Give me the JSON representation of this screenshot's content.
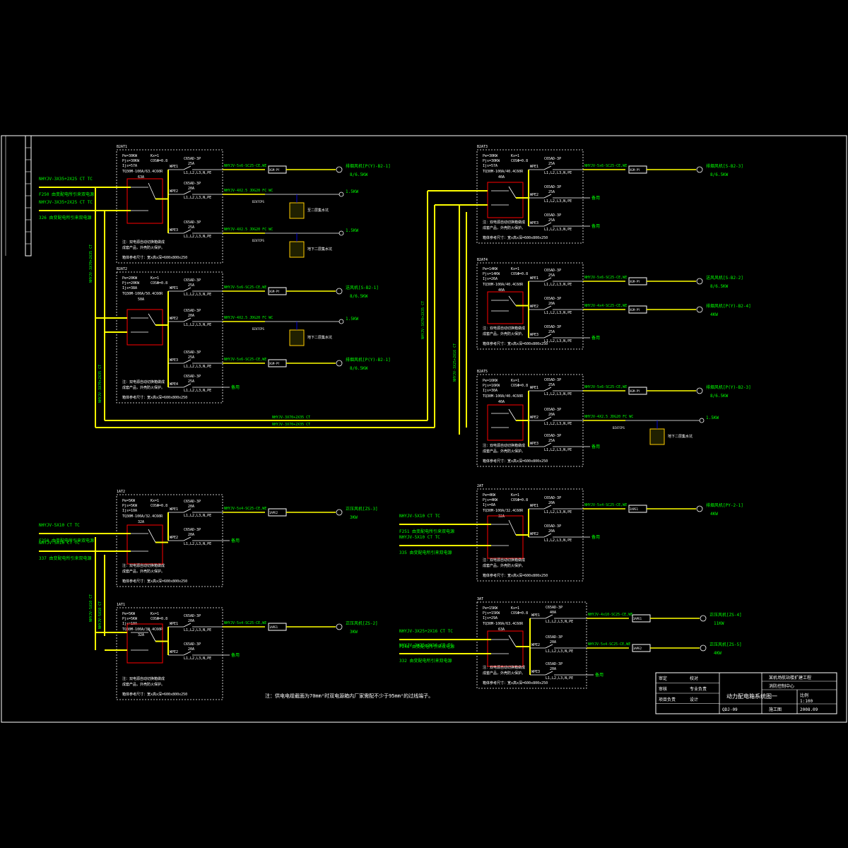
{
  "note": "注：供电电缆截面为70mm²时双电源箱内厂家需配不少于95mm²的过线端子。",
  "title_block": {
    "project": "某机场航站楼扩建工程",
    "sub_project": "消防控制中心",
    "drawing_title": "动力配电箱系统图一",
    "drawing_no": "QDJ-09",
    "labels": [
      "审定",
      "校对",
      "审核",
      "专业负责",
      "设计",
      "项目负责"
    ],
    "scale_label": "比例",
    "scale": "1:100",
    "date": "2008.09",
    "stage": "施工图"
  },
  "panels": [
    {
      "id": "AP1",
      "name": "B2AT1",
      "params": [
        "Pe=30KW",
        "Kx=1",
        "Pjs=30KW",
        "COSΦ=0.8",
        "Ijs=57A"
      ],
      "atse": "TQ30M-100A/63.4C60R",
      "atse_rating": "63A",
      "sources": [
        {
          "cable": "NHYJV-3X35+2X25 CT TC",
          "desc": "F250 由变配电所引来双电源"
        },
        {
          "cable": "NHYJV-3X35+2X25 CT TC",
          "desc": "326 由变配电所引来双电源"
        }
      ],
      "notes": [
        "注：双电源自动切换箱做成",
        "成套产品，外壳防火保护。"
      ],
      "size": "箱体参考尺寸：宽x高x深=600x800x250",
      "circuits": [
        {
          "no": "WPE1",
          "breaker": "C65AD-3P",
          "rating": "25A",
          "phase": "L1,L2,L3,N,PE",
          "cable": "NHYJV-5x6-SC25-CE,WE",
          "device": "XGM-PY",
          "load": "排烟风机[P(Y)-B2-1]",
          "power": "8/6.5KW"
        },
        {
          "no": "WPE2",
          "breaker": "C65AD-3P",
          "rating": "20A",
          "phase": "L1,L2,L3,N,PE",
          "cable": "NHYJV-4X2.5 JDG20 FC WC",
          "device": "DZ47CPS",
          "load": "1.5KW",
          "extra": "至二层集水坑"
        },
        {
          "no": "WPE3",
          "breaker": "C65AD-3P",
          "rating": "25A",
          "phase": "L1,L2,L3,N,PE",
          "cable": "NHYJV-4X2.5 JDG20 FC WC",
          "device": "DZ47CPS",
          "load": "1.5KW",
          "extra": "地下二层集水坑"
        }
      ]
    },
    {
      "id": "AP2",
      "name": "B2AT2",
      "params": [
        "Pe=20KW",
        "Kx=1",
        "Pjs=20KW",
        "COSΦ=0.8",
        "Ijs=38A"
      ],
      "atse": "TQ30M-100A/50.4C60R",
      "atse_rating": "50A",
      "notes": [
        "注：双电源自动切换箱做成",
        "成套产品，外壳防火保护。"
      ],
      "size": "箱体参考尺寸：宽x高x深=600x800x250",
      "circuits": [
        {
          "no": "WPE1",
          "breaker": "C65AD-3P",
          "rating": "25A",
          "phase": "L1,L2,L3,N,PE",
          "cable": "NHYJV-5x6-SC25-CE,WE",
          "device": "XGM-PY",
          "load": "送风机[S-B2-1]",
          "power": "8/6.5KW"
        },
        {
          "no": "WPE2",
          "breaker": "C65AD-3P",
          "rating": "20A",
          "phase": "L1,L2,L3,N,PE",
          "cable": "NHYJV-4X2.5 JDG20 FC WC",
          "device": "DZ47CPS",
          "load": "1.5KW",
          "extra": "地下二层集水坑"
        },
        {
          "no": "WPE3",
          "breaker": "C65AD-3P",
          "rating": "25A",
          "phase": "L1,L2,L3,N,PE",
          "cable": "NHYJV-5x6-SC25-CE,WE",
          "device": "XGM-PY",
          "load": "排烟风机[P(Y)-B2-1]",
          "power": "8/6.5KW"
        },
        {
          "no": "WPE4",
          "breaker": "C65AD-3P",
          "rating": "25A",
          "phase": "L1,L2,L3,N,PE",
          "load": "备用"
        }
      ]
    },
    {
      "id": "AP3",
      "name": "B2AT3",
      "params": [
        "Pe=30KW",
        "Kx=1",
        "Pjs=30KW",
        "COSΦ=0.8",
        "Ijs=57A"
      ],
      "atse": "TQ30M-100A/40.4C60R",
      "atse_rating": "40A",
      "notes": [
        "注：双电源自动切换箱做成",
        "成套产品，外壳防火保护。"
      ],
      "size": "箱体参考尺寸：宽x高x深=600x800x250",
      "circuits": [
        {
          "no": "WPE1",
          "breaker": "C65AD-3P",
          "rating": "25A",
          "phase": "L1,L2,L3,N,PE",
          "cable": "NHYJV-5x6-SC25-CE,WE",
          "device": "XGM-PY",
          "load": "排烟风机[S-B2-3]",
          "power": "8/6.5KW"
        },
        {
          "no": "WPE2",
          "breaker": "C65AD-3P",
          "rating": "25A",
          "phase": "L1,L2,L3,N,PE",
          "load": "备用"
        },
        {
          "no": "WPE3",
          "breaker": "C65AD-3P",
          "rating": "25A",
          "phase": "L1,L2,L3,N,PE",
          "load": "备用"
        }
      ]
    },
    {
      "id": "AP4",
      "name": "B2AT4",
      "params": [
        "Pe=14KW",
        "Kx=1",
        "Pjs=14KW",
        "COSΦ=0.8",
        "Ijs=26A"
      ],
      "atse": "TQ30M-100A/40.4C60R",
      "atse_rating": "40A",
      "notes": [
        "注：双电源自动切换箱做成",
        "成套产品，外壳防火保护。"
      ],
      "size": "箱体参考尺寸：宽x高x深=600x800x250",
      "circuits": [
        {
          "no": "WPE1",
          "breaker": "C65AD-3P",
          "rating": "25A",
          "phase": "L1,L2,L3,N,PE",
          "cable": "NHYJV-5x6-SC25-CE,WE",
          "device": "XGM-PY",
          "load": "送风风机[S-B2-2]",
          "power": "8/6.5KW"
        },
        {
          "no": "WPE2",
          "breaker": "C65AD-3P",
          "rating": "20A",
          "phase": "L1,L2,L3,N,PE",
          "cable": "NHYJV-4x4-SC25-CE,WE",
          "device": "XGM-PY",
          "load": "排烟风机[P(Y)-B2-4]",
          "power": "4KW"
        },
        {
          "no": "WPE3",
          "breaker": "C65AD-3P",
          "rating": "25A",
          "phase": "L1,L2,L3,N,PE",
          "load": "备用"
        }
      ]
    },
    {
      "id": "AP5",
      "name": "B2AT5",
      "params": [
        "Pe=16KW",
        "Kx=1",
        "Pjs=16KW",
        "COSΦ=0.8",
        "Ijs=30A"
      ],
      "atse": "TQ30M-100A/40.4C60R",
      "atse_rating": "40A",
      "notes": [
        "注：双电源自动切换箱做成",
        "成套产品，外壳防火保护。"
      ],
      "size": "箱体参考尺寸：宽x高x深=600x800x250",
      "circuits": [
        {
          "no": "WPE1",
          "breaker": "C65AD-3P",
          "rating": "25A",
          "phase": "L1,L2,L3,N,PE",
          "cable": "NHYJV-5x6-SC25-CE,WE",
          "device": "XGM-PY",
          "load": "排烟风机[P(Y)-B2-3]",
          "power": "8/6.5KW"
        },
        {
          "no": "WPE2",
          "breaker": "C65AD-3P",
          "rating": "20A",
          "phase": "L1,L2,L3,N,PE",
          "cable": "NHYJV-4X2.5 JDG20 FC WC",
          "device": "DZ47CPS",
          "load": "1.5KW",
          "extra": "地下二层集水坑"
        },
        {
          "no": "WPE3",
          "breaker": "C65AD-3P",
          "rating": "25A",
          "phase": "L1,L2,L3,N,PE",
          "load": "备用"
        }
      ]
    },
    {
      "id": "AP6",
      "name": "1AT2",
      "params": [
        "Pe=5KW",
        "Kx=1",
        "Pjs=5KW",
        "COSΦ=0.8",
        "Ijs=10A"
      ],
      "atse": "TQ30M-100A/32.4C60R",
      "atse_rating": "32A",
      "sources": [
        {
          "cable": "NHYJV-5X10 CT TC",
          "desc": "F250 由变配电所引来双电源"
        },
        {
          "cable": "NHYJV-5X10 CT TC",
          "desc": "337 由变配电所引来双电源"
        }
      ],
      "notes": [
        "注：双电源自动切换箱做成",
        "成套产品，外壳防火保护。"
      ],
      "size": "箱体参考尺寸：宽x高x深=600x800x250",
      "circuits": [
        {
          "no": "WPE1",
          "breaker": "C65AD-3P",
          "rating": "20A",
          "phase": "L1,L2,L3,N,PE",
          "cable": "NHYJV-5x4-SC25-CE,WE",
          "device": "1APE2",
          "load": "正压风机[ZS-3]",
          "power": "3KW"
        },
        {
          "no": "WPE2",
          "breaker": "C65AD-3P",
          "rating": "20A",
          "phase": "L1,L2,L3,N,PE",
          "load": "备用"
        }
      ]
    },
    {
      "id": "AP7",
      "name": "1AT1",
      "params": [
        "Pe=5KW",
        "Kx=1",
        "Pjs=5KW",
        "COSΦ=0.8",
        "Ijs=10A"
      ],
      "atse": "TQ30M-100A/32.4C60R",
      "atse_rating": "32A",
      "notes": [
        "注：双电源自动切换箱做成",
        "成套产品，外壳防火保护。"
      ],
      "size": "箱体参考尺寸：宽x高x深=600x800x250",
      "circuits": [
        {
          "no": "WPE1",
          "breaker": "C65AD-3P",
          "rating": "20A",
          "phase": "L1,L2,L3,N,PE",
          "cable": "NHYJV-5x4-SC25-CE,WE",
          "device": "1APE1",
          "load": "正压风机[ZS-2]",
          "power": "3KW"
        },
        {
          "no": "WPE2",
          "breaker": "C65AD-3P",
          "rating": "20A",
          "phase": "L1,L2,L3,N,PE",
          "load": "备用"
        }
      ]
    },
    {
      "id": "AP8",
      "name": "2AT",
      "params": [
        "Pe=4KW",
        "Kx=1",
        "Pjs=4KW",
        "COSΦ=0.8",
        "Ijs=8A"
      ],
      "atse": "TQ30M-100A/32.4C60R",
      "atse_rating": "32A",
      "sources": [
        {
          "cable": "NHYJV-5X10 CT TC",
          "desc": "F251 由变配电所引来双电源"
        },
        {
          "cable": "NHYJV-5X10 CT TC",
          "desc": "335 由变配电所引来双电源"
        }
      ],
      "notes": [
        "注：双电源自动切换箱做成",
        "成套产品，外壳防火保护。"
      ],
      "size": "箱体参考尺寸：宽x高x深=600x800x250",
      "circuits": [
        {
          "no": "WPE1",
          "breaker": "C65AD-3P",
          "rating": "20A",
          "phase": "L1,L2,L3,N,PE",
          "cable": "NHYJV-5x4-SC25-CE,WE",
          "device": "2APE1",
          "load": "排烟风机[PY-2-1]",
          "power": "4KW"
        },
        {
          "no": "WPE2",
          "breaker": "C65AD-3P",
          "rating": "20A",
          "phase": "L1,L2,L3,N,PE",
          "load": "备用"
        }
      ]
    },
    {
      "id": "AP9",
      "name": "3AT",
      "params": [
        "Pe=15KW",
        "Kx=1",
        "Pjs=15KW",
        "COSΦ=0.8",
        "Ijs=29A"
      ],
      "atse": "TQ30M-100A/63.4C60R",
      "atse_rating": "63A",
      "sources": [
        {
          "cable": "NHYJV-3X25+2X16 CT TC",
          "desc": "F248 由变配电所引来双电源"
        },
        {
          "cable": "NHYJV-3X25+2X16 CT TC",
          "desc": "332 由变配电所引来双电源"
        }
      ],
      "notes": [
        "注：双电源自动切换箱做成",
        "成套产品，外壳防火保护。"
      ],
      "size": "箱体参考尺寸：宽x高x深=600x800x250",
      "circuits": [
        {
          "no": "WPE1",
          "breaker": "C65AD-3P",
          "rating": "40A",
          "phase": "L1,L2,L3,N,PE",
          "cable": "NHYJV-4x10-SC25-CE,WE",
          "device": "3APE1",
          "load": "正压风机[ZS-4]",
          "power": "11KW"
        },
        {
          "no": "WPE2",
          "breaker": "C65AD-3P",
          "rating": "20A",
          "phase": "L1,L2,L3,N,PE",
          "cable": "NHYJV-5x4-SC25-CE,WE",
          "device": "3APE2",
          "load": "正压风机[ZS-5]",
          "power": "4KW"
        },
        {
          "no": "WPE3",
          "breaker": "C65AD-3P",
          "rating": "20A",
          "phase": "L1,L2,L3,N,PE",
          "load": "备用"
        }
      ]
    }
  ],
  "feeders": {
    "left_riser_a": "NHYJV-3X70+2X35 CT",
    "left_riser_b": "NHYJV-3X70+2X35 CT",
    "bottom_bus_a": "NHYJV-3X70+2X35 CT",
    "bottom_bus_b": "NHYJV-3X70+2X35 CT",
    "right_riser_a": "NHYJV-3X70+2X35 CT",
    "right_riser_b": "NHYJV-3X25+2X16 CT",
    "lower_left_riser_a": "NHYJV-5X10 CT",
    "lower_left_riser_b": "NHYJV-5X10 CT"
  },
  "colors": {
    "background": "#000000",
    "frame": "#ffffff",
    "bus": "#ffff00",
    "text_white": "#ffffff",
    "text_green": "#00ff00",
    "switch_red": "#ff0000",
    "text_cyan": "#00ffff",
    "device_fill": "#ffff00",
    "pump_box": "#ffcc00",
    "control_line": "#0000ff",
    "magenta": "#ff00ff"
  }
}
